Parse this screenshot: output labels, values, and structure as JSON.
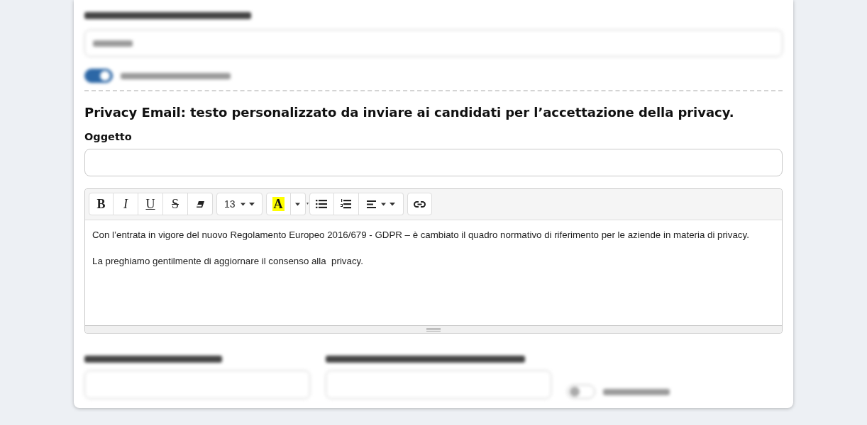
{
  "upper_section": {
    "privacy_toggle": {
      "on": true
    }
  },
  "privacy_email": {
    "heading": "Privacy Email: testo personalizzato da inviare ai candidati per l’accettazione della privacy.",
    "subject": {
      "label": "Oggetto"
    },
    "editor": {
      "toolbar": [
        {
          "items": [
            {
              "kind": "bold",
              "label": "B"
            },
            {
              "kind": "italic",
              "label": "I"
            },
            {
              "kind": "underline",
              "label": "U"
            },
            {
              "kind": "strikethrough",
              "label": "S"
            },
            {
              "kind": "eraser"
            }
          ]
        },
        {
          "items": [
            {
              "kind": "font_size",
              "label": "13"
            }
          ]
        },
        {
          "items": [
            {
              "kind": "text_color",
              "label": "A",
              "color": "#ffff00"
            },
            {
              "kind": "color_menu"
            }
          ]
        },
        {
          "items": [
            {
              "kind": "bullet_list"
            },
            {
              "kind": "numbered_list"
            },
            {
              "kind": "align"
            }
          ]
        },
        {
          "items": [
            {
              "kind": "link"
            }
          ]
        }
      ],
      "paragraphs": [
        "Con l’entrata in vigore del nuovo Regolamento Europeo 2016/679 - GDPR – è cambiato il quadro normativo di riferimento per le aziende in materia di privacy.",
        "La preghiamo gentilmente di aggiornare il consenso alla  privacy."
      ]
    }
  },
  "lower_section": {
    "job_privacy_toggle": {
      "on": false
    }
  }
}
